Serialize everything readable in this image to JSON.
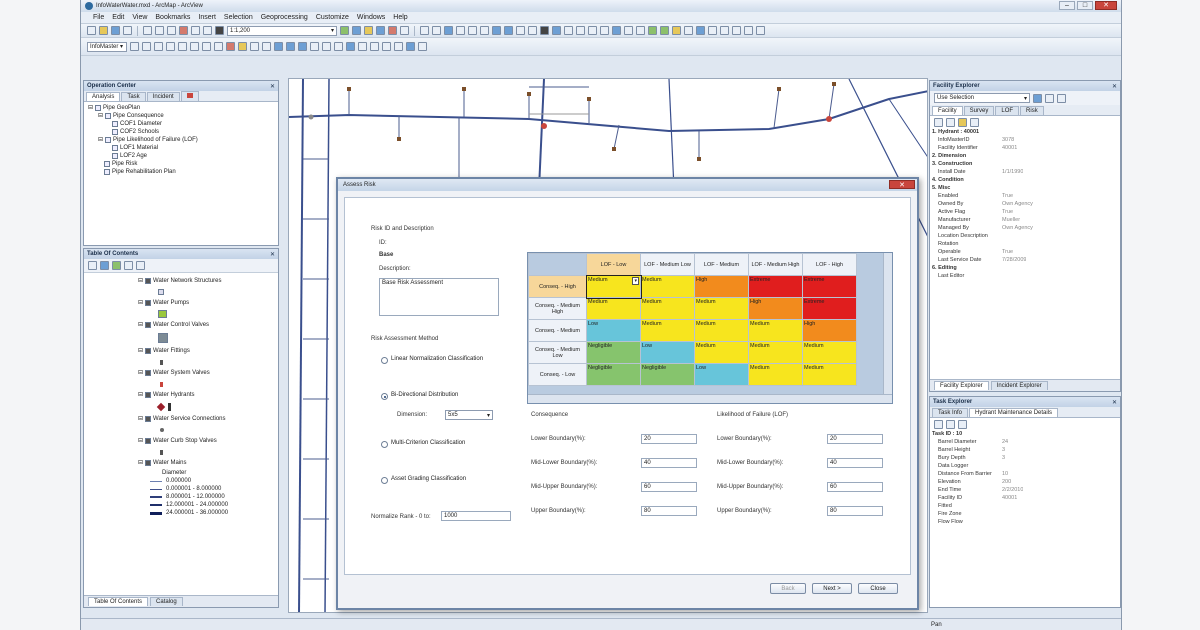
{
  "window": {
    "title": "InfoWaterWater.mxd - ArcMap - ArcView"
  },
  "menu": [
    "File",
    "Edit",
    "View",
    "Bookmarks",
    "Insert",
    "Selection",
    "Geoprocessing",
    "Customize",
    "Windows",
    "Help"
  ],
  "toolbar": {
    "scale": "1:1,200",
    "toolbar2_label": "InfoMaster ▾"
  },
  "operation_center": {
    "title": "Operation Center",
    "tabs": [
      "Analysis",
      "Task",
      "Incident",
      ""
    ],
    "tree": [
      "Pipe GeoPlan",
      "Pipe Consequence",
      "COF1 Diameter",
      "COF2 Schools",
      "Pipe Likelihood of Failure (LOF)",
      "LOF1 Material",
      "LOF2 Age",
      "Pipe Risk",
      "Pipe Rehabilitation Plan"
    ]
  },
  "toc": {
    "title": "Table Of Contents",
    "layers": [
      "Water Network Structures",
      "Water Pumps",
      "Water Control Valves",
      "Water Fittings",
      "Water System Valves",
      "Water Hydrants",
      "Water Service Connections",
      "Water Curb Stop Valves",
      "Water Mains",
      "Diameter",
      "0.000000",
      "0.000001 - 8.000000",
      "8.000001 - 12.000000",
      "12.000001 - 24.000000",
      "24.000001 - 36.000000"
    ],
    "bottom_tabs": [
      "Table Of Contents",
      "Catalog"
    ]
  },
  "dialog": {
    "title": "Assess Risk",
    "risk_id_header": "Risk ID and Description",
    "id_label": "ID:",
    "id_value": "Base",
    "description_label": "Description:",
    "description_value": "Base Risk Assessment",
    "method_header": "Risk Assessment Method",
    "methods": [
      {
        "label": "Linear Normalization Classification",
        "selected": false
      },
      {
        "label": "Bi-Directional Distribution",
        "selected": true
      },
      {
        "label": "Multi-Criterion Classification",
        "selected": false
      },
      {
        "label": "Asset Grading Classification",
        "selected": false
      }
    ],
    "dimension_label": "Dimension:",
    "dimension_value": "5x5",
    "normalize_label": "Normalize Rank - 0 to:",
    "normalize_value": "1000",
    "matrix": {
      "columns": [
        "LOF - Low",
        "LOF - Medium Low",
        "LOF - Medium",
        "LOF - Medium High",
        "LOF - High"
      ],
      "rows": [
        {
          "label": "Conseq. - High",
          "cells": [
            "Medium",
            "Medium",
            "High",
            "Extreme",
            "Extreme"
          ]
        },
        {
          "label": "Conseq. - Medium High",
          "cells": [
            "Medium",
            "Medium",
            "Medium",
            "High",
            "Extreme"
          ]
        },
        {
          "label": "Conseq. - Medium",
          "cells": [
            "Low",
            "Medium",
            "Medium",
            "Medium",
            "High"
          ]
        },
        {
          "label": "Conseq. - Medium Low",
          "cells": [
            "Negligible",
            "Low",
            "Medium",
            "Medium",
            "Medium"
          ]
        },
        {
          "label": "Conseq. - Low",
          "cells": [
            "Negligible",
            "Negligible",
            "Low",
            "Medium",
            "Medium"
          ]
        }
      ],
      "colors": {
        "Negligible": "#86c46d",
        "Low": "#67c5da",
        "Medium": "#f7e51e",
        "High": "#f28b1d",
        "Extreme": "#e01e1e"
      }
    },
    "consequence": {
      "title": "Consequence",
      "fields": [
        {
          "label": "Lower Boundary(%):",
          "value": "20"
        },
        {
          "label": "Mid-Lower Boundary(%):",
          "value": "40"
        },
        {
          "label": "Mid-Upper Boundary(%):",
          "value": "60"
        },
        {
          "label": "Upper Boundary(%):",
          "value": "80"
        }
      ]
    },
    "lof": {
      "title": "Likelihood of Failure (LOF)",
      "fields": [
        {
          "label": "Lower Boundary(%):",
          "value": "20"
        },
        {
          "label": "Mid-Lower Boundary(%):",
          "value": "40"
        },
        {
          "label": "Mid-Upper Boundary(%):",
          "value": "60"
        },
        {
          "label": "Upper Boundary(%):",
          "value": "80"
        }
      ]
    },
    "buttons": {
      "back": "Back",
      "next": "Next >",
      "close": "Close"
    }
  },
  "facility_explorer": {
    "title": "Facility Explorer",
    "selection": "Use Selection",
    "tabs": [
      "Facility",
      "Survey",
      "LOF",
      "Risk"
    ],
    "props": [
      {
        "k": "1. Hydrant : 40001",
        "v": "",
        "h": true
      },
      {
        "k": "InfoMasterID",
        "v": "3078",
        "h": false
      },
      {
        "k": "Facility Identifier",
        "v": "40001",
        "h": false
      },
      {
        "k": "2. Dimension",
        "v": "",
        "h": true
      },
      {
        "k": "3. Construction",
        "v": "",
        "h": true
      },
      {
        "k": "Install Date",
        "v": "1/1/1990",
        "h": false
      },
      {
        "k": "4. Condition",
        "v": "",
        "h": true
      },
      {
        "k": "5. Misc",
        "v": "",
        "h": true
      },
      {
        "k": "Enabled",
        "v": "True",
        "h": false
      },
      {
        "k": "Owned By",
        "v": "Own Agency",
        "h": false
      },
      {
        "k": "Active Flag",
        "v": "True",
        "h": false
      },
      {
        "k": "Manufacturer",
        "v": "Mueller",
        "h": false
      },
      {
        "k": "Managed By",
        "v": "Own Agency",
        "h": false
      },
      {
        "k": "Location Description",
        "v": "",
        "h": false
      },
      {
        "k": "Rotation",
        "v": "",
        "h": false
      },
      {
        "k": "Operable",
        "v": "True",
        "h": false
      },
      {
        "k": "Last Service Date",
        "v": "7/28/2009",
        "h": false
      },
      {
        "k": "6. Editing",
        "v": "",
        "h": true
      },
      {
        "k": "Last Editor",
        "v": "",
        "h": false
      }
    ],
    "bottom_tabs": [
      "Facility Explorer",
      "Incident Explorer"
    ]
  },
  "task_explorer": {
    "title": "Task Explorer",
    "tabs": [
      "Task Info",
      "Hydrant Maintenance Details"
    ],
    "props": [
      {
        "k": "Task ID : 10",
        "v": "",
        "h": true
      },
      {
        "k": "Barrel Diameter",
        "v": "24",
        "h": false
      },
      {
        "k": "Barrel Height",
        "v": "3",
        "h": false
      },
      {
        "k": "Bury Depth",
        "v": "3",
        "h": false
      },
      {
        "k": "Data Logger",
        "v": "",
        "h": false
      },
      {
        "k": "Distance From Barrier",
        "v": "10",
        "h": false
      },
      {
        "k": "Elevation",
        "v": "200",
        "h": false
      },
      {
        "k": "End Time",
        "v": "2/2/2010",
        "h": false
      },
      {
        "k": "Facility ID",
        "v": "40001",
        "h": false
      },
      {
        "k": "Fitted",
        "v": "",
        "h": false
      },
      {
        "k": "Fire Zone",
        "v": "",
        "h": false
      },
      {
        "k": "Flow Flow",
        "v": "",
        "h": false
      }
    ]
  },
  "status": {
    "text": "Pan"
  }
}
